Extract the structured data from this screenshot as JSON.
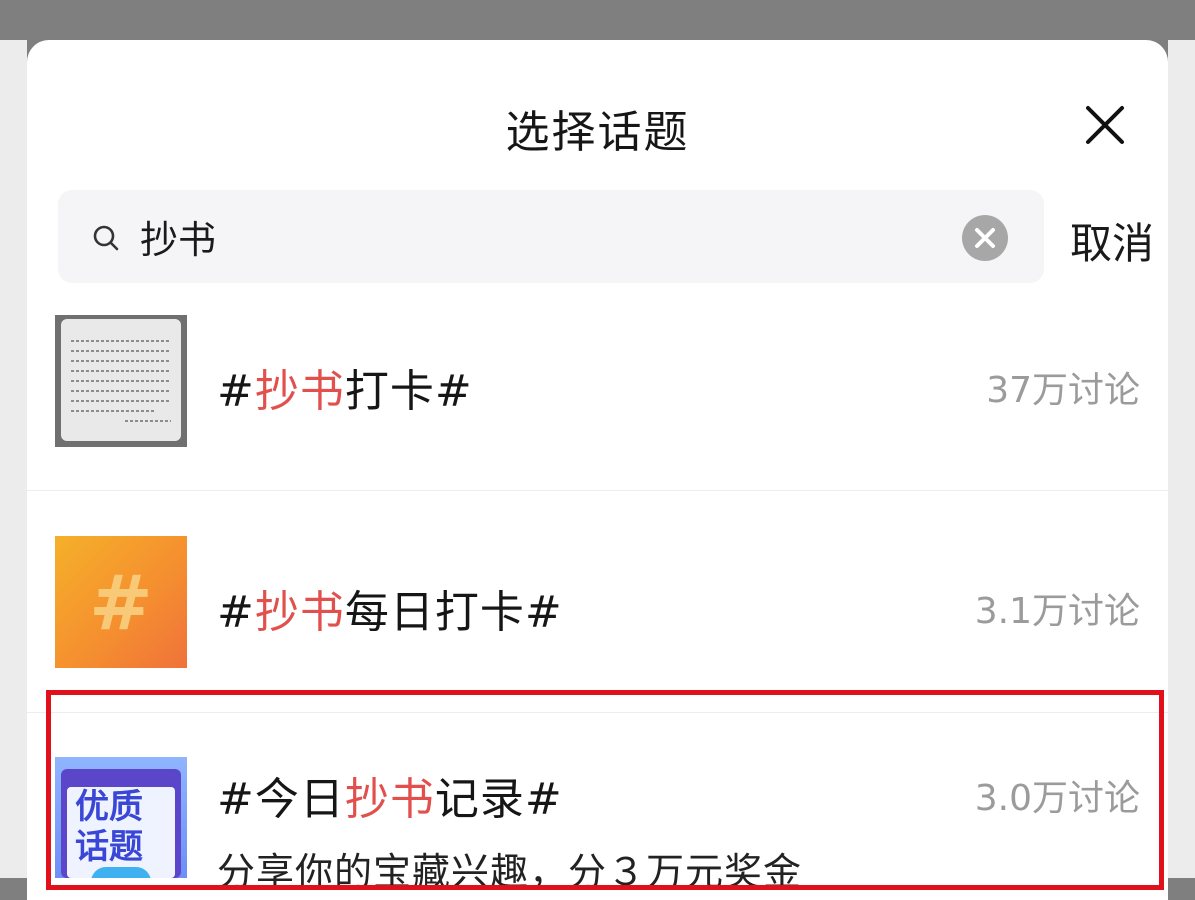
{
  "header": {
    "title": "选择话题"
  },
  "search": {
    "value": "抄书",
    "cancel_label": "取消"
  },
  "topics": [
    {
      "hash_open": "#",
      "prefix": "",
      "keyword": "抄书",
      "suffix": "打卡",
      "hash_close": "#",
      "count": "37万讨论",
      "thumb": "handwritten-page-thumbnail"
    },
    {
      "hash_open": "#",
      "prefix": "",
      "keyword": "抄书",
      "suffix": "每日打卡",
      "hash_close": "#",
      "count": "3.1万讨论",
      "thumb": "hashtag-thumbnail",
      "thumb_glyph": "#"
    },
    {
      "hash_open": "#",
      "prefix": "今日",
      "keyword": "抄书",
      "suffix": "记录",
      "hash_close": "#",
      "count": "3.0万讨论",
      "thumb": "quality-topic-thumbnail",
      "thumb_text": [
        "优质",
        "话题"
      ],
      "description": "分享你的宝藏兴趣，分３万元奖金"
    }
  ],
  "colors": {
    "keyword_highlight": "#e2504d",
    "highlight_border": "#e0111a"
  }
}
